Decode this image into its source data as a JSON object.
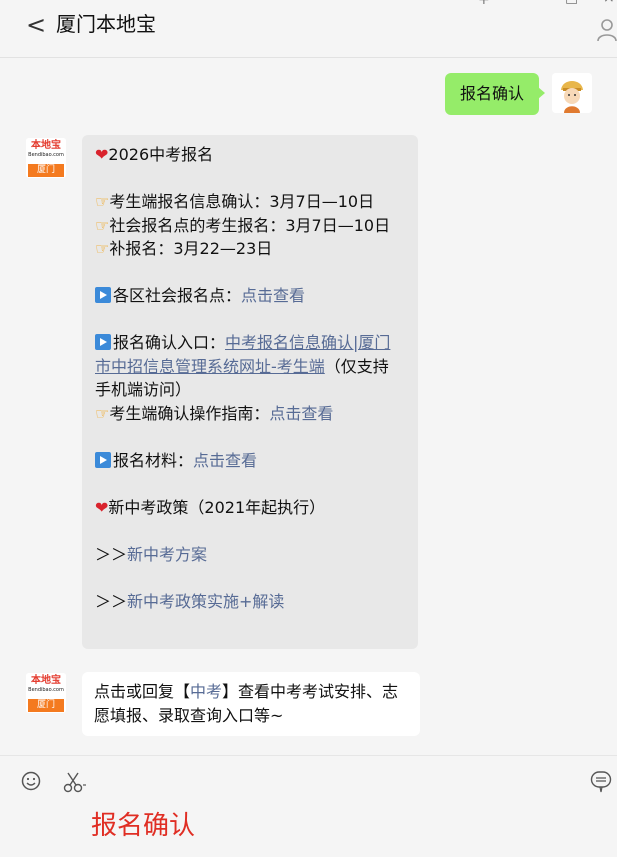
{
  "header": {
    "back": "<",
    "title": "厦门本地宝"
  },
  "outgoing": {
    "text": "报名确认"
  },
  "logo": {
    "name": "本地宝",
    "url": "Bendibao.com",
    "city": "厦门"
  },
  "reply": {
    "lines": [
      {
        "type": "heart",
        "text": "2026中考报名"
      },
      {
        "type": "blank"
      },
      {
        "type": "hand",
        "text": "考生端报名信息确认：3月7日—10日"
      },
      {
        "type": "hand",
        "text": "社会报名点的考生报名：3月7日—10日"
      },
      {
        "type": "hand",
        "text": "补报名：3月22—23日"
      },
      {
        "type": "blank"
      },
      {
        "type": "play",
        "text": "各区社会报名点：",
        "link": "点击查看"
      },
      {
        "type": "blank"
      },
      {
        "type": "play",
        "text": "报名确认入口：",
        "ulink": "中考报名信息确认|厦门市中招信息管理系统网址-考生端",
        "tail": "（仅支持手机端访问）"
      },
      {
        "type": "hand",
        "text": "考生端确认操作指南：",
        "link": "点击查看"
      },
      {
        "type": "blank"
      },
      {
        "type": "play",
        "text": "报名材料：",
        "link": "点击查看"
      },
      {
        "type": "blank"
      },
      {
        "type": "heart",
        "text": "新中考政策（2021年起执行）"
      },
      {
        "type": "blank"
      },
      {
        "type": "arrow",
        "text": "＞＞",
        "link": "新中考方案"
      },
      {
        "type": "blank"
      },
      {
        "type": "arrow",
        "text": "＞＞",
        "link": "新中考政策实施+解读"
      }
    ]
  },
  "tip": {
    "pre": "点击或回复【",
    "key": "中考",
    "post": "】查看中考考试安排、志愿填报、录取查询入口等~"
  },
  "input": {
    "text": "报名确认"
  },
  "icons": {
    "back": "back-arrow-icon",
    "user": "user-icon",
    "emoji": "emoji-icon",
    "scissor": "scissor-icon",
    "chat": "chat-menu-icon"
  }
}
